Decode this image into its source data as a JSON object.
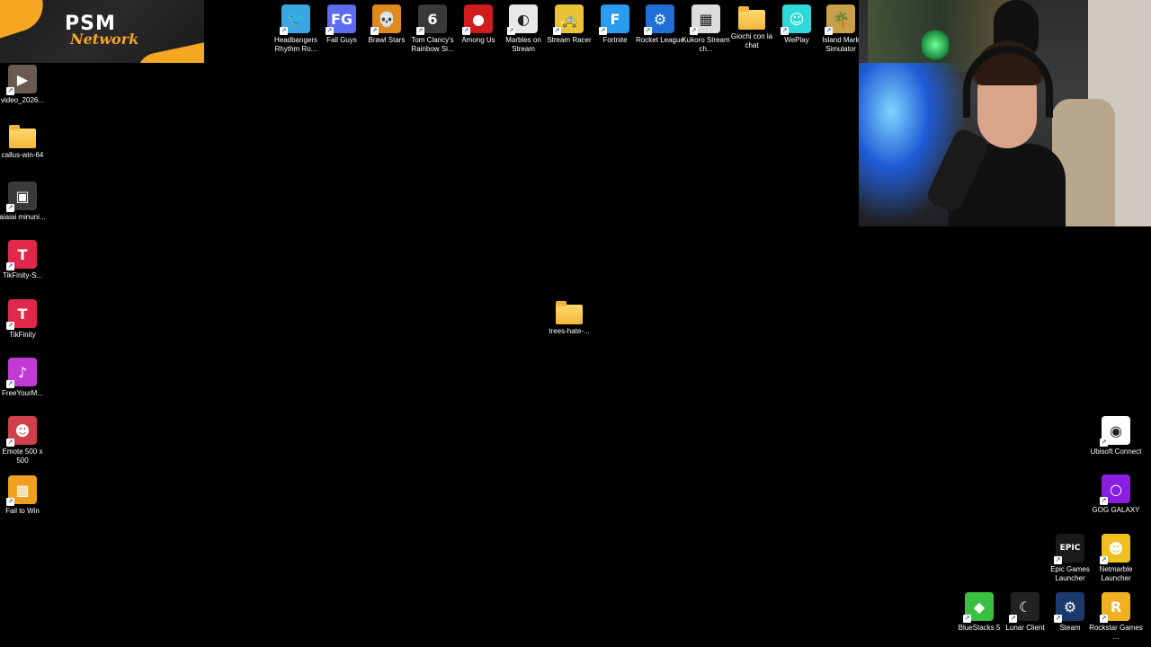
{
  "logo": {
    "brand": "PSM",
    "sub": "Network"
  },
  "top_icons": [
    {
      "label": "Headbangers Rhythm Ro...",
      "icon": "headbangers-icon",
      "color": "#3aa7e0",
      "glyph": "🐦"
    },
    {
      "label": "Fall Guys",
      "icon": "fall-guys-icon",
      "color": "#5b6cf0",
      "glyph": "FG"
    },
    {
      "label": "Brawl Stars",
      "icon": "brawl-stars-icon",
      "color": "#e08a1e",
      "glyph": "💀"
    },
    {
      "label": "Tom Clancy's Rainbow Si...",
      "icon": "rainbow-six-icon",
      "color": "#3a3a3a",
      "glyph": "6"
    },
    {
      "label": "Among Us",
      "icon": "among-us-icon",
      "color": "#d01c1c",
      "glyph": "●"
    },
    {
      "label": "Marbles on Stream",
      "icon": "marbles-icon",
      "color": "#e8e8e8",
      "glyph": "◐"
    },
    {
      "label": "Stream Racer",
      "icon": "stream-racer-icon",
      "color": "#e8c33a",
      "glyph": "🚕"
    },
    {
      "label": "Fortnite",
      "icon": "fortnite-icon",
      "color": "#2a9cf0",
      "glyph": "F"
    },
    {
      "label": "Rocket League",
      "icon": "rocket-league-icon",
      "color": "#1f6fd6",
      "glyph": "⚙"
    },
    {
      "label": "Kukoro Stream ch...",
      "icon": "kukoro-icon",
      "color": "#dcdcdc",
      "glyph": "▦"
    },
    {
      "label": "Giochi con la chat",
      "icon": "folder-icon",
      "color": "#f3b73b",
      "glyph": ""
    },
    {
      "label": "WePlay",
      "icon": "weplay-icon",
      "color": "#2fd9d9",
      "glyph": "☺"
    },
    {
      "label": "Island Mark Simulator",
      "icon": "island-market-icon",
      "color": "#c9a04a",
      "glyph": "🌴"
    }
  ],
  "left_icons": [
    {
      "label": "video_2026...",
      "icon": "video-file-icon",
      "color": "#6a5a50",
      "glyph": "▶"
    },
    {
      "label": "callus-win-64",
      "icon": "folder-icon",
      "color": "#f3b73b",
      "glyph": ""
    },
    {
      "label": "aiaiai minuni...",
      "icon": "image-file-icon",
      "color": "#3a3a3a",
      "glyph": "▣"
    },
    {
      "label": "TikFinity-S...",
      "icon": "tikfinity-icon",
      "color": "#e0284a",
      "glyph": "T"
    },
    {
      "label": "TikFinity",
      "icon": "tikfinity-icon",
      "color": "#e0284a",
      "glyph": "T"
    },
    {
      "label": "FreeYourM...",
      "icon": "freeyourmusic-icon",
      "color": "#c23ad6",
      "glyph": "♪"
    },
    {
      "label": "Emote 500 x 500",
      "icon": "emote-image-icon",
      "color": "#d0404a",
      "glyph": "☻"
    },
    {
      "label": "Fail to Win",
      "icon": "fail-to-win-icon",
      "color": "#f0a020",
      "glyph": "▩"
    }
  ],
  "center_icon": {
    "label": "trees-hate-...",
    "icon": "folder-icon"
  },
  "right_icons": [
    {
      "label": "Ubisoft Connect",
      "icon": "ubisoft-icon",
      "color": "#ffffff",
      "glyph": "◉"
    },
    {
      "label": "GOG GALAXY",
      "icon": "gog-galaxy-icon",
      "color": "#8a1ee0",
      "glyph": "○"
    },
    {
      "label": "Epic Games Launcher",
      "icon": "epic-games-icon",
      "color": "#1a1a1a",
      "glyph": "EPIC"
    },
    {
      "label": "Netmarble Launcher",
      "icon": "netmarble-icon",
      "color": "#f0c020",
      "glyph": "☻"
    },
    {
      "label": "BlueStacks 5",
      "icon": "bluestacks-icon",
      "color": "#3ac040",
      "glyph": "◆"
    },
    {
      "label": "Lunar Client",
      "icon": "lunar-client-icon",
      "color": "#222222",
      "glyph": "☾"
    },
    {
      "label": "Steam",
      "icon": "steam-icon",
      "color": "#1b3a6b",
      "glyph": "⚙"
    },
    {
      "label": "Rockstar Games ...",
      "icon": "rockstar-icon",
      "color": "#f0b020",
      "glyph": "R"
    }
  ]
}
